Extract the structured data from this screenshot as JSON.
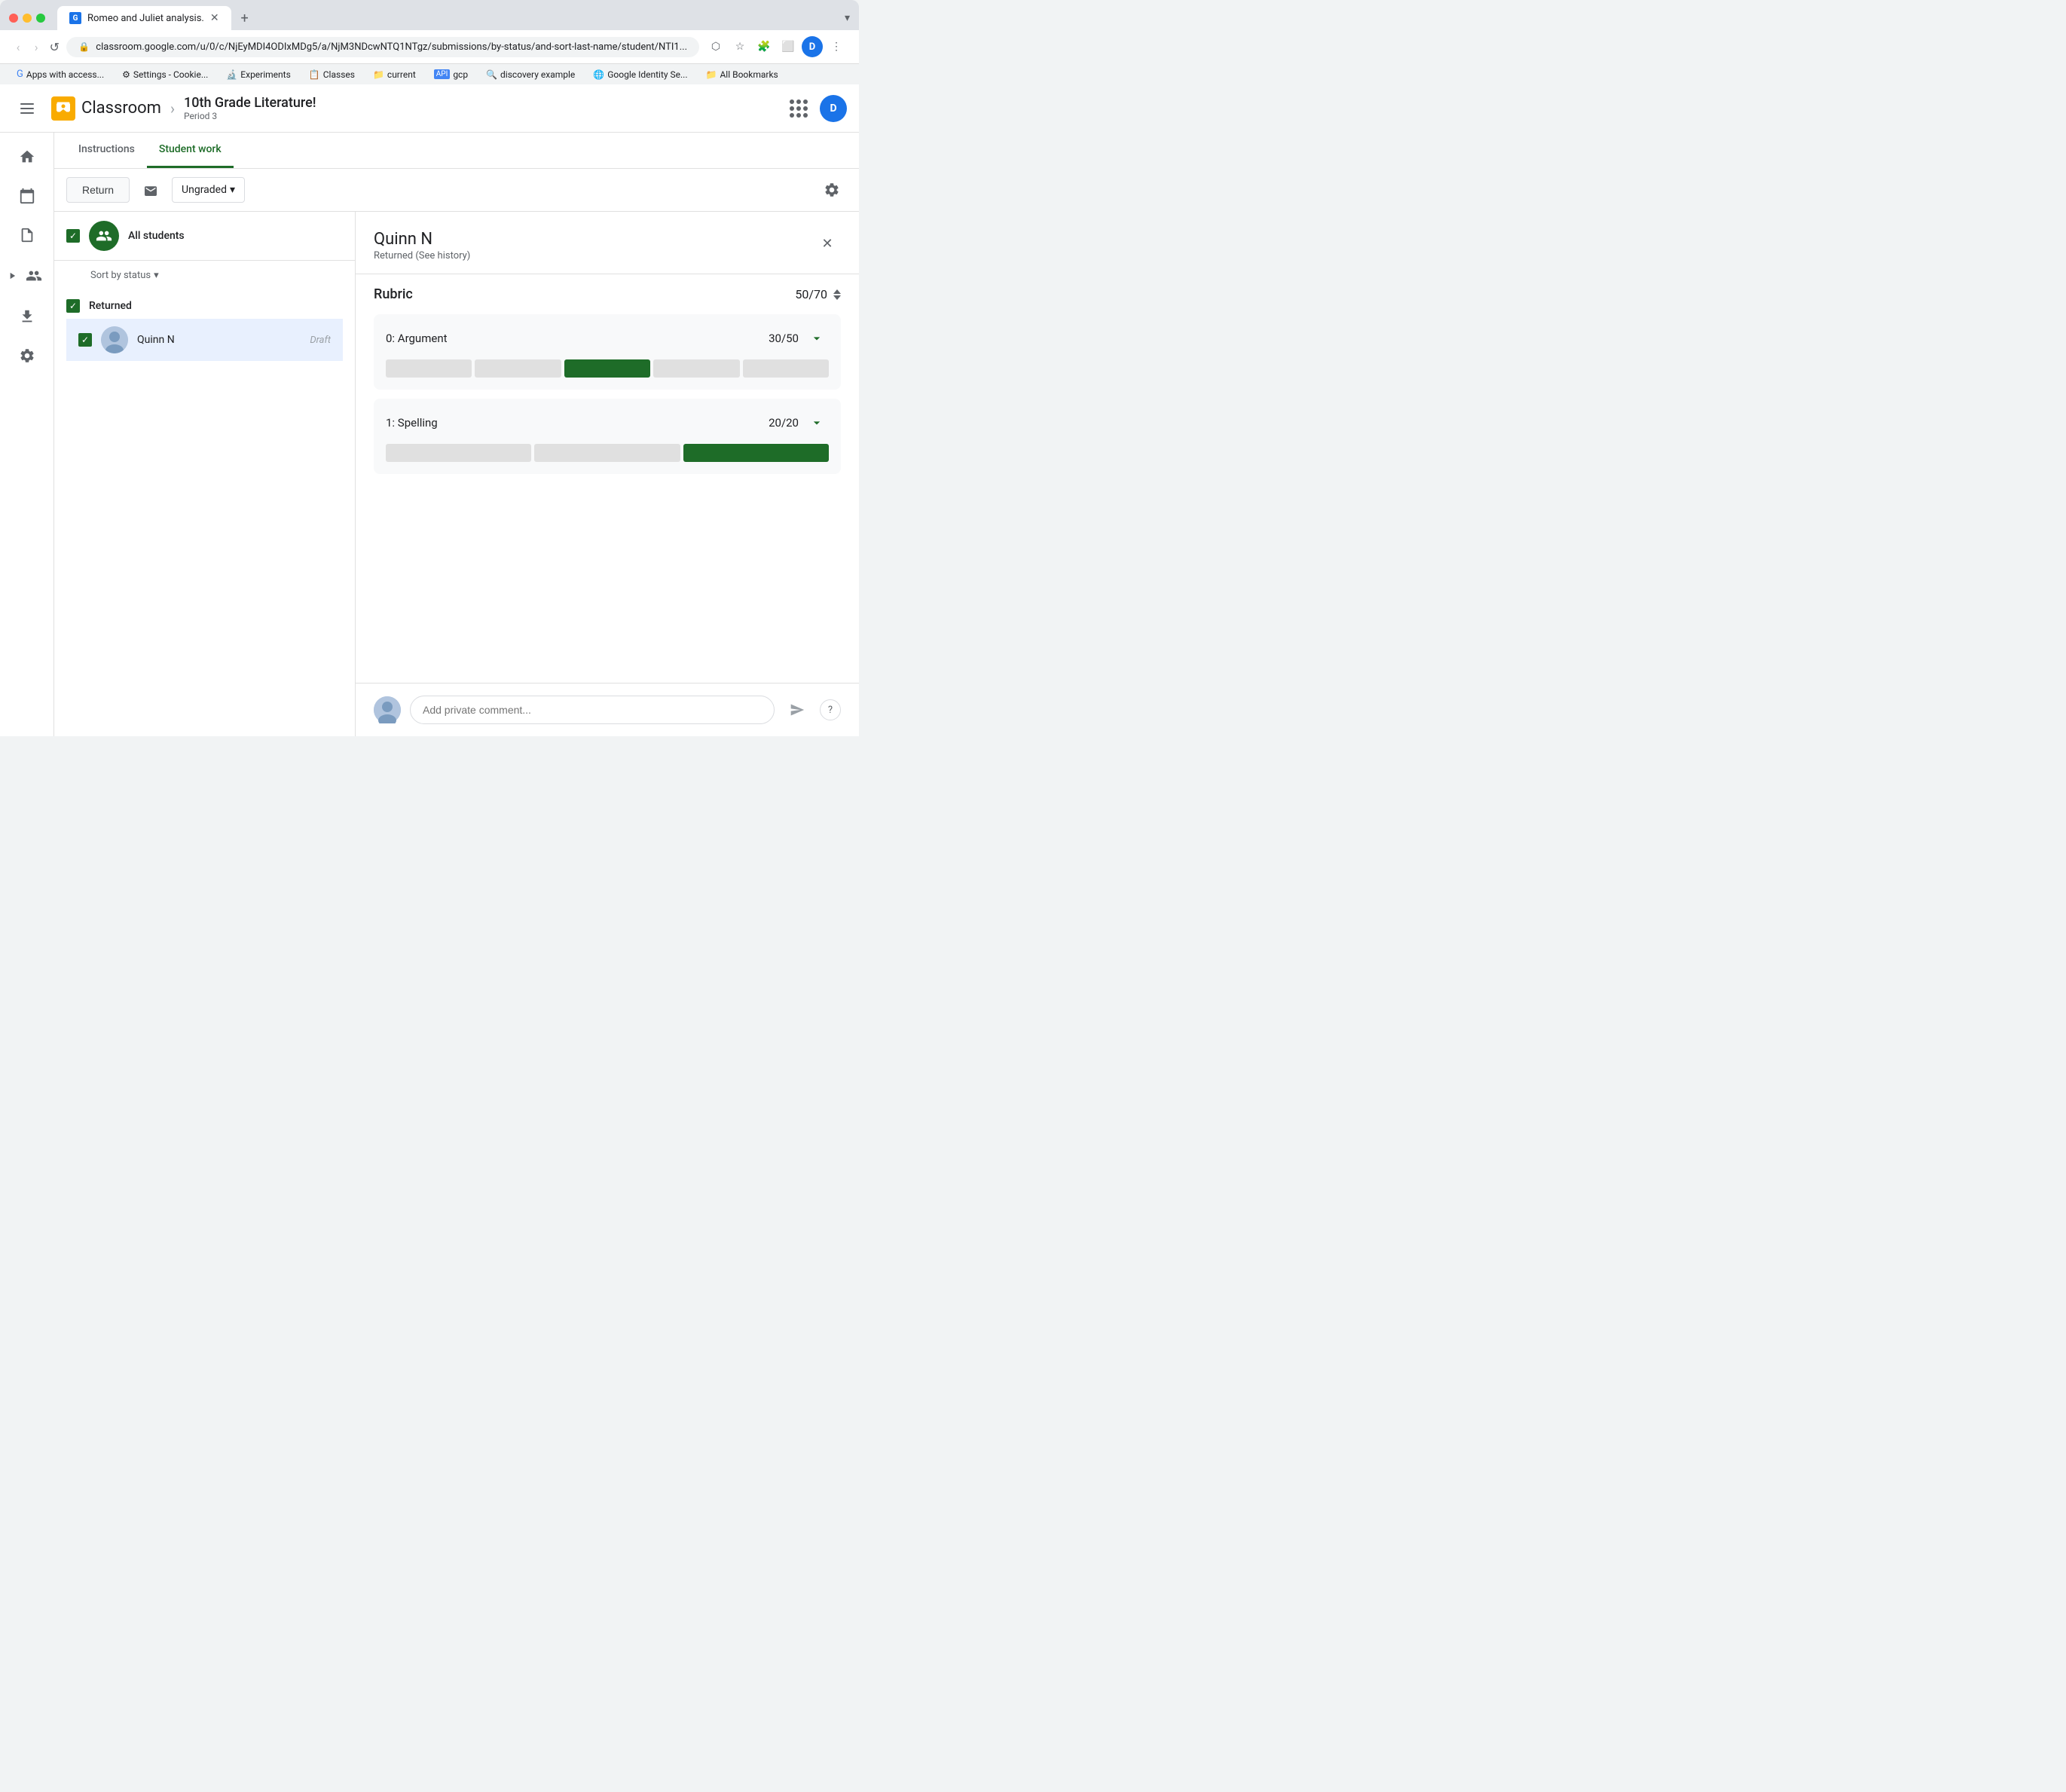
{
  "browser": {
    "tab_title": "Romeo and Juliet analysis.",
    "url": "classroom.google.com/u/0/c/NjEyMDI4ODIxMDg5/a/NjM3NDcwNTQ1NTgz/submissions/by-status/and-sort-last-name/student/NTI1...",
    "profile_initial": "D",
    "overflow_label": "▾",
    "bookmarks": [
      {
        "label": "Apps with access...",
        "icon": "G"
      },
      {
        "label": "Settings - Cookie...",
        "icon": "⚙"
      },
      {
        "label": "Experiments",
        "icon": "🔬"
      },
      {
        "label": "Classes",
        "icon": "📋"
      },
      {
        "label": "current",
        "icon": "📁"
      },
      {
        "label": "gcp",
        "icon": "API"
      },
      {
        "label": "discovery example",
        "icon": "🔍"
      },
      {
        "label": "Google Identity Se...",
        "icon": "🌐"
      },
      {
        "label": "All Bookmarks",
        "icon": "📁"
      }
    ]
  },
  "header": {
    "hamburger_label": "☰",
    "logo_label": "Classroom",
    "course_title": "10th Grade Literature!",
    "course_period": "Period 3",
    "user_initial": "D"
  },
  "tabs": {
    "instructions_label": "Instructions",
    "student_work_label": "Student work"
  },
  "toolbar": {
    "return_label": "Return",
    "grade_filter": "Ungraded",
    "grade_filter_arrow": "▾"
  },
  "student_list": {
    "all_students_label": "All students",
    "sort_label": "Sort by status",
    "status_section_label": "Returned",
    "students": [
      {
        "name": "Quinn N",
        "status": "Draft"
      }
    ]
  },
  "detail": {
    "student_name": "Quinn N",
    "student_status": "Returned (See history)",
    "rubric_label": "Rubric",
    "rubric_total_score": "50/70",
    "criteria": [
      {
        "name": "0: Argument",
        "score": "30/50",
        "bar_total": 5,
        "bar_filled_index": 2,
        "bar_filled_count": 1
      },
      {
        "name": "1: Spelling",
        "score": "20/20",
        "bar_total": 3,
        "bar_filled_index": 2,
        "bar_filled_count": 1
      }
    ],
    "comment_placeholder": "Add private comment..."
  },
  "sidebar_icons": [
    "home",
    "calendar",
    "assignment",
    "person-group",
    "upload",
    "settings"
  ]
}
